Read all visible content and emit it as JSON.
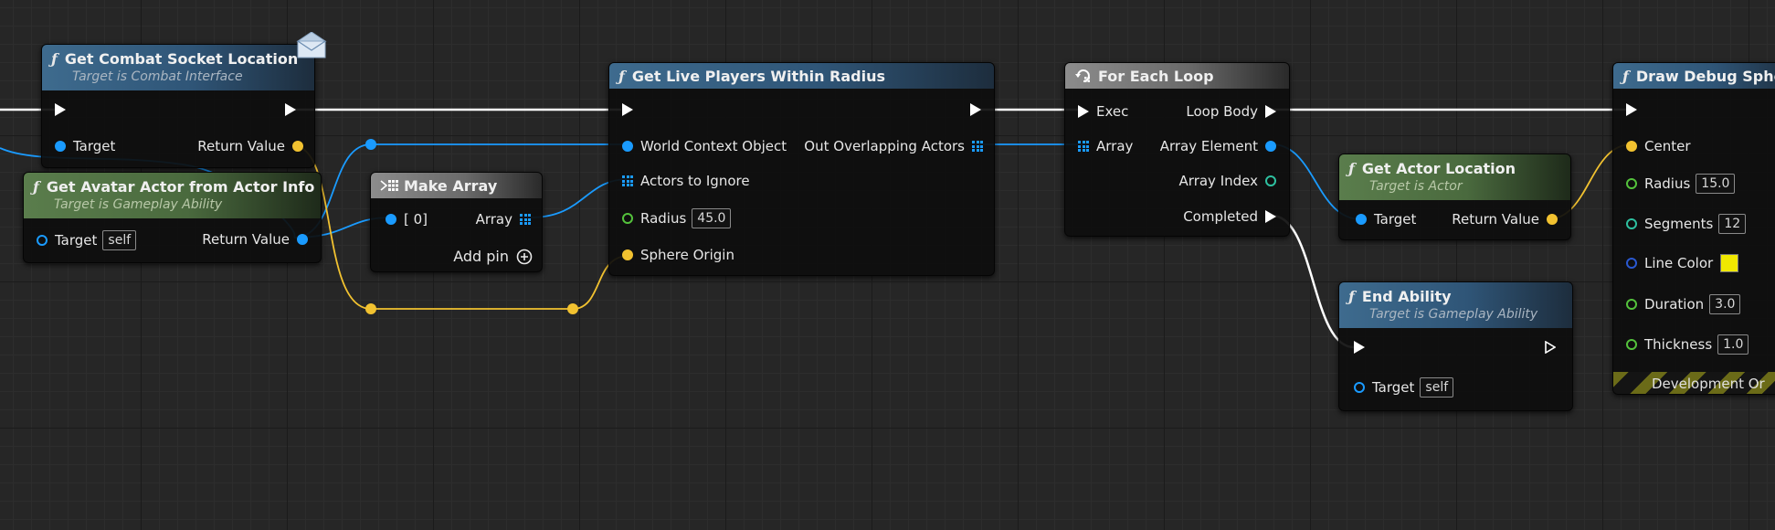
{
  "colors": {
    "exec_wire": "#ffffff",
    "object_wire": "#1a9bff",
    "vector_wire": "#f2c230",
    "float_pin": "#54c23c",
    "int_pin": "#2ec0a0",
    "color_pin": "#2a58d0",
    "line_color_value": "#f0e800"
  },
  "nodes": {
    "get_combat_socket": {
      "title": "Get Combat Socket Location",
      "subtitle": "Target is Combat Interface",
      "icon": "function-icon",
      "badge_icon": "message-envelope-icon",
      "pins": {
        "target": "Target",
        "return_value": "Return Value"
      }
    },
    "get_avatar_actor": {
      "title": "Get Avatar Actor from Actor Info",
      "subtitle": "Target is Gameplay Ability",
      "icon": "function-icon",
      "pins": {
        "target": "Target",
        "target_default": "self",
        "return_value": "Return Value"
      }
    },
    "make_array": {
      "title": "Make Array",
      "icon": "make-array-icon",
      "pins": {
        "index0": "[ 0]",
        "array": "Array",
        "add_pin": "Add pin"
      }
    },
    "get_live_players": {
      "title": "Get Live Players Within Radius",
      "icon": "function-icon",
      "pins": {
        "world_context": "World Context Object",
        "out_overlapping": "Out Overlapping Actors",
        "actors_to_ignore": "Actors to Ignore",
        "radius": "Radius",
        "radius_value": "45.0",
        "sphere_origin": "Sphere Origin"
      }
    },
    "for_each_loop": {
      "title": "For Each Loop",
      "icon": "loop-icon",
      "pins": {
        "exec": "Exec",
        "loop_body": "Loop Body",
        "array": "Array",
        "array_element": "Array Element",
        "array_index": "Array Index",
        "completed": "Completed"
      }
    },
    "get_actor_location": {
      "title": "Get Actor Location",
      "subtitle": "Target is Actor",
      "icon": "function-icon",
      "pins": {
        "target": "Target",
        "return_value": "Return Value"
      }
    },
    "end_ability": {
      "title": "End Ability",
      "subtitle": "Target is Gameplay Ability",
      "icon": "function-icon",
      "pins": {
        "target": "Target",
        "target_default": "self"
      }
    },
    "draw_debug_sphere": {
      "title": "Draw Debug Sphe",
      "icon": "function-icon",
      "pins": {
        "center": "Center",
        "radius": "Radius",
        "radius_value": "15.0",
        "segments": "Segments",
        "segments_value": "12",
        "line_color": "Line Color",
        "duration": "Duration",
        "duration_value": "3.0",
        "thickness": "Thickness",
        "thickness_value": "1.0"
      },
      "footer": "Development Or"
    }
  }
}
